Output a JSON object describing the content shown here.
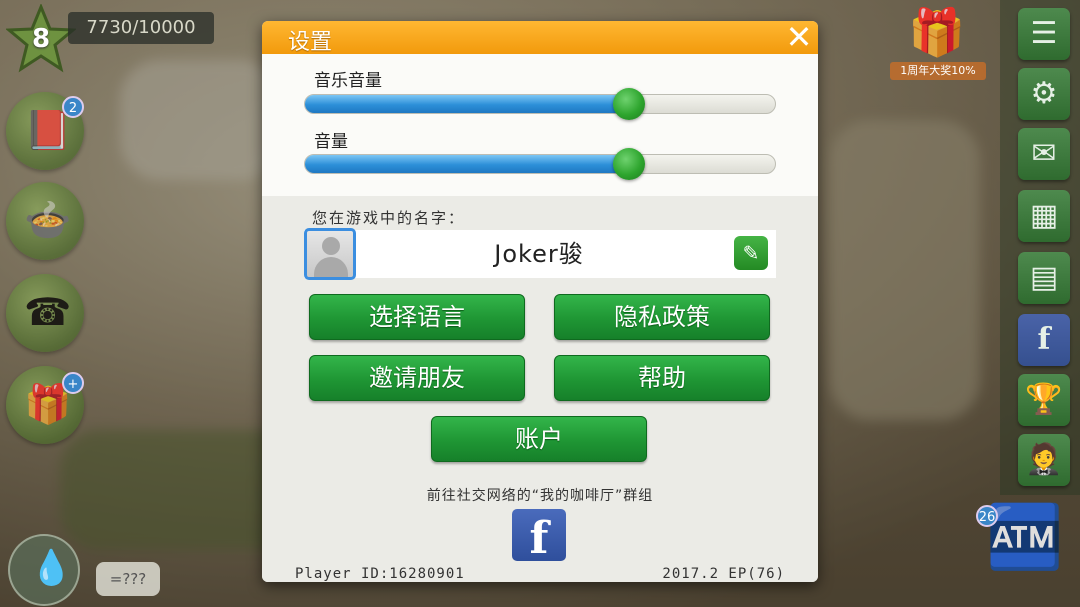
{
  "hud": {
    "level": "8",
    "xp": "7730/10000",
    "book_badge": "2",
    "bubble_text": "=???",
    "gift_label": "1周年大奖10%",
    "register_badge": "26"
  },
  "dialog": {
    "title": "设置",
    "close_icon": "close-icon",
    "music_volume": {
      "label": "音乐音量",
      "value": 0.69
    },
    "sound_volume": {
      "label": "音量",
      "value": 0.69
    },
    "name_label": "您在游戏中的名字：",
    "player_name": "Joker骏",
    "buttons": {
      "language": "选择语言",
      "privacy": "隐私政策",
      "invite": "邀请朋友",
      "help": "帮助",
      "account": "账户"
    },
    "social_text": "前往社交网络的“我的咖啡厅”群组",
    "facebook_icon": "f",
    "player_id": "Player ID:16280901",
    "version": "2017.2 EP(76)"
  },
  "colors": {
    "header_orange": "#f7a41d",
    "button_green": "#22993a",
    "slider_blue": "#2c8fd8",
    "knob_green": "#2ea52e"
  }
}
